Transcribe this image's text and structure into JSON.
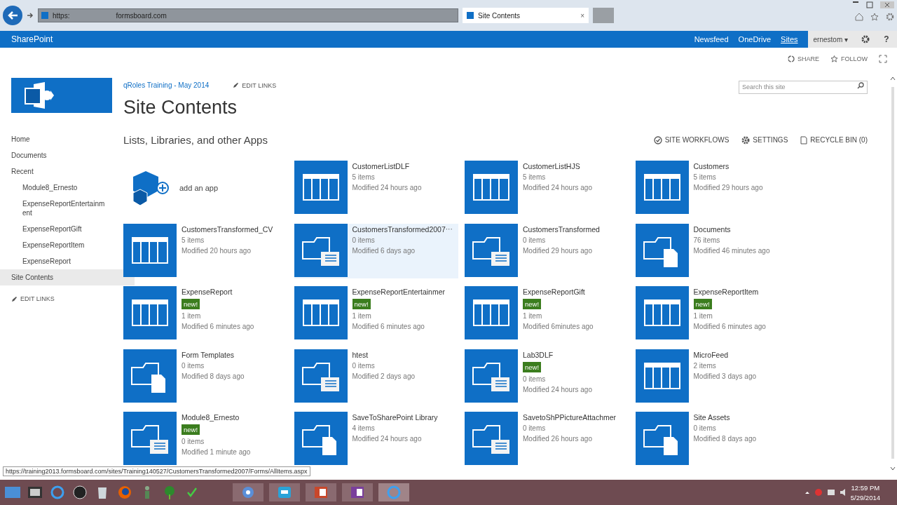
{
  "browser": {
    "address": "https:",
    "address_host": "formsboard.com",
    "tab": {
      "title": "Site Contents",
      "close": "×"
    }
  },
  "suite_bar": {
    "brand": "SharePoint",
    "links": [
      {
        "label": "Newsfeed",
        "selected": false
      },
      {
        "label": "OneDrive",
        "selected": false
      },
      {
        "label": "Sites",
        "selected": true
      }
    ],
    "user": "ernestom ▾",
    "help": "?"
  },
  "actions": [
    "SHARE",
    "FOLLOW"
  ],
  "breadcrumb": {
    "site": "qRoles Training - May 2014",
    "edit": "EDIT LINKS"
  },
  "title": "Site Contents",
  "search": {
    "placeholder": "Search this site"
  },
  "nav": {
    "items": [
      {
        "label": "Home",
        "selected": false
      },
      {
        "label": "Documents",
        "selected": false
      },
      {
        "label": "Recent",
        "selected": false,
        "children": [
          {
            "label": "Module8_Ernesto"
          },
          {
            "label": "ExpenseReportEntertainment"
          },
          {
            "label": "ExpenseReportGift"
          },
          {
            "label": "ExpenseReportItem"
          },
          {
            "label": "ExpenseReport"
          }
        ]
      },
      {
        "label": "Site Contents",
        "selected": true
      }
    ],
    "edit": "EDIT LINKS"
  },
  "section": {
    "heading": "Lists, Libraries, and other Apps",
    "tools": [
      {
        "kind": "workflows",
        "label": "SITE WORKFLOWS"
      },
      {
        "kind": "settings",
        "label": "SETTINGS"
      },
      {
        "kind": "recycle",
        "label": "RECYCLE BIN (0)"
      }
    ]
  },
  "add_app": "add an app",
  "tiles": [
    {
      "name": "CustomerListDLF",
      "kind": "list",
      "items": "5 items",
      "modified": "Modified 24 hours ago",
      "highlighted": false
    },
    {
      "name": "CustomerListHJS",
      "kind": "list",
      "items": "5 items",
      "modified": "Modified 24 hours ago",
      "highlighted": false
    },
    {
      "name": "Customers",
      "kind": "list",
      "items": "5 items",
      "modified": "Modified 29 hours ago",
      "highlighted": false
    },
    {
      "name": "CustomersTransformed_CV",
      "kind": "list",
      "items": "5 items",
      "modified": "Modified 20 hours ago",
      "highlighted": false
    },
    {
      "name": "CustomersTransformed2007",
      "kind": "library",
      "items": "0 items",
      "modified": "Modified 6 days ago",
      "highlighted": true,
      "more": "···"
    },
    {
      "name": "CustomersTransformed",
      "kind": "library",
      "items": "0 items",
      "modified": "Modified 29 hours ago",
      "highlighted": false
    },
    {
      "name": "Documents",
      "kind": "doclib",
      "items": "76 items",
      "modified": "Modified 46 minutes ago",
      "highlighted": false
    },
    {
      "name": "ExpenseReport",
      "kind": "list",
      "badge": "new!",
      "items": "1 item",
      "modified": "Modified 6 minutes ago",
      "highlighted": false
    },
    {
      "name": "ExpenseReportEntertainmer",
      "kind": "list",
      "badge": "new!",
      "items": "1 item",
      "modified": "Modified 6 minutes ago",
      "highlighted": false
    },
    {
      "name": "ExpenseReportGift",
      "kind": "list",
      "badge": "new!",
      "items": "1 item",
      "modified": "Modified 6minutes ago",
      "highlighted": false
    },
    {
      "name": "ExpenseReportItem",
      "kind": "list",
      "badge": "new!",
      "items": "1 item",
      "modified": "Modified 6 minutes ago",
      "highlighted": false
    },
    {
      "name": "Form Templates",
      "kind": "doclib",
      "items": "0 items",
      "modified": "Modified 8 days ago",
      "highlighted": false
    },
    {
      "name": "htest",
      "kind": "library",
      "items": "0 items",
      "modified": "Modified 2 days ago",
      "highlighted": false
    },
    {
      "name": "Lab3DLF",
      "kind": "library",
      "badge": "new!",
      "items": "0 items",
      "modified": "Modified 24 hours ago",
      "highlighted": false
    },
    {
      "name": "MicroFeed",
      "kind": "list",
      "items": "2 items",
      "modified": "Modified 3 days ago",
      "highlighted": false
    },
    {
      "name": "Module8_Ernesto",
      "kind": "library",
      "badge": "new!",
      "items": "0 items",
      "modified": "Modified 1 minute ago",
      "highlighted": false
    },
    {
      "name": "SaveToSharePoint Library",
      "kind": "doclib",
      "items": "4 items",
      "modified": "Modified 24 hours ago",
      "highlighted": false
    },
    {
      "name": "SavetoShPPictureAttachmer",
      "kind": "library",
      "items": "0 items",
      "modified": "Modified 26 hours ago",
      "highlighted": false
    },
    {
      "name": "Site Assets",
      "kind": "doclib",
      "items": "0 items",
      "modified": "Modified 8 days ago",
      "highlighted": false
    }
  ],
  "status_url": "https://training2013.formsboard.com/sites/Training140527/CustomersTransformed2007/Forms/AllItems.aspx",
  "clock": {
    "time": "12:59 PM",
    "date": "5/29/2014"
  }
}
